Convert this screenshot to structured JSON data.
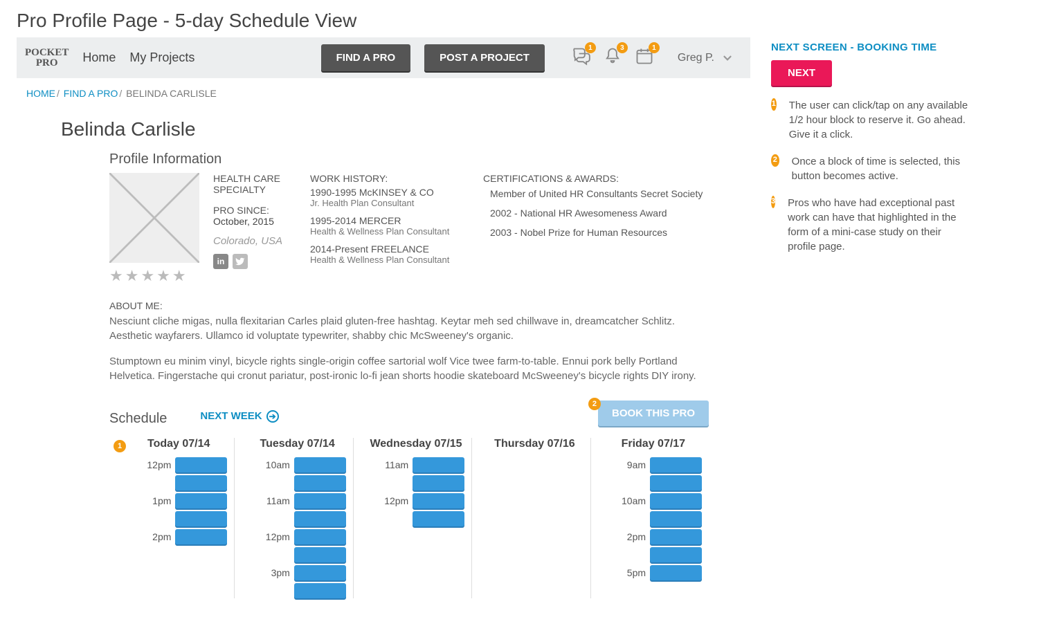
{
  "page_title": "Pro Profile Page - 5-day Schedule View",
  "brand_line1": "POCKET",
  "brand_line2": "PRO",
  "nav": {
    "home": "Home",
    "projects": "My Projects"
  },
  "top_buttons": {
    "find": "FIND A PRO",
    "post": "POST A PROJECT"
  },
  "top_badges": {
    "chat": "1",
    "bell": "3",
    "cal": "1"
  },
  "user_name": "Greg P.",
  "crumbs": {
    "home": "HOME",
    "find": "FIND A PRO",
    "current": "BELINDA CARLISLE"
  },
  "profile": {
    "name": "Belinda Carlisle",
    "section_label": "Profile Information",
    "specialty_label": "HEALTH CARE SPECIALTY",
    "since_label": "PRO SINCE:",
    "since_value": "October, 2015",
    "location": "Colorado, USA",
    "work_label": "WORK HISTORY:",
    "work": [
      {
        "title": "1990-1995 McKINSEY & CO",
        "sub": "Jr. Health Plan Consultant"
      },
      {
        "title": "1995-2014 MERCER",
        "sub": "Health & Wellness Plan Consultant"
      },
      {
        "title": "2014-Present FREELANCE",
        "sub": "Health & Wellness Plan Consultant"
      }
    ],
    "cert_label": "CERTIFICATIONS & AWARDS:",
    "certs": [
      "Member of United HR Consultants Secret Society",
      "2002 - National HR Awesomeness Award",
      "2003 - Nobel Prize for Human Resources"
    ],
    "about_label": "ABOUT ME:",
    "about_p1": "Nesciunt cliche migas, nulla flexitarian Carles plaid gluten-free hashtag. Keytar meh sed chillwave in, dreamcatcher Schlitz. Aesthetic wayfarers. Ullamco id voluptate typewriter, shabby chic McSweeney's organic.",
    "about_p2": "Stumptown eu minim vinyl, bicycle rights single-origin coffee sartorial wolf Vice twee farm-to-table. Ennui pork belly Portland Helvetica. Fingerstache qui cronut pariatur, post-ironic lo-fi jean shorts hoodie skateboard McSweeney's bicycle rights DIY irony."
  },
  "schedule": {
    "label": "Schedule",
    "next_week": "NEXT WEEK",
    "book_label": "BOOK THIS PRO",
    "days": [
      {
        "header": "Today 07/14",
        "slots": [
          "12pm",
          "",
          "1pm",
          "",
          "2pm"
        ]
      },
      {
        "header": "Tuesday 07/14",
        "slots": [
          "10am",
          "",
          "11am",
          "",
          "12pm",
          "",
          "3pm",
          ""
        ]
      },
      {
        "header": "Wednesday 07/15",
        "slots": [
          "11am",
          "",
          "12pm",
          ""
        ]
      },
      {
        "header": "Thursday 07/16",
        "slots": []
      },
      {
        "header": "Friday 07/17",
        "slots": [
          "9am",
          "",
          "10am",
          "",
          "2pm",
          "",
          "5pm"
        ]
      }
    ]
  },
  "sidebar": {
    "link": "NEXT SCREEN - BOOKING TIME",
    "next_label": "NEXT",
    "annotations": [
      {
        "n": "1",
        "text": "The user can click/tap on any available 1/2 hour block to reserve it. Go ahead. Give it a click."
      },
      {
        "n": "2",
        "text": "Once a block of time is selected, this button becomes active."
      },
      {
        "n": "3",
        "text": "Pros who have had exceptional past work can have that highlighted in the form of a mini-case study on their profile page."
      }
    ]
  }
}
